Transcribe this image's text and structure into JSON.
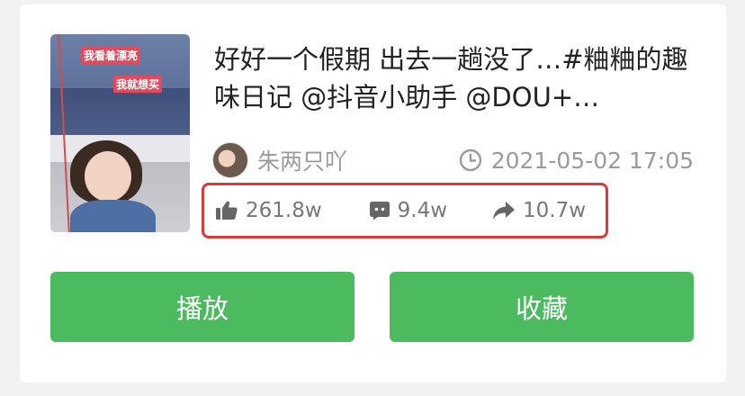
{
  "video": {
    "title": "好好一个假期 出去一趟没了…#粬粬的趣味日记 @抖音小助手 @DOU+…",
    "thumbnail_caption_1": "我看着漂亮",
    "thumbnail_caption_2": "我就想买",
    "author": "朱两只吖",
    "timestamp": "2021-05-02 17:05"
  },
  "stats": {
    "likes": "261.8w",
    "comments": "9.4w",
    "shares": "10.7w"
  },
  "actions": {
    "play_label": "播放",
    "favorite_label": "收藏"
  },
  "colors": {
    "accent_green": "#4cbb60",
    "highlight_red": "#d93b3b",
    "muted_text": "#9b9b9b"
  },
  "icons": {
    "time": "clock-icon",
    "likes": "thumbs-up-icon",
    "comments": "comment-icon",
    "shares": "share-arrow-icon"
  }
}
